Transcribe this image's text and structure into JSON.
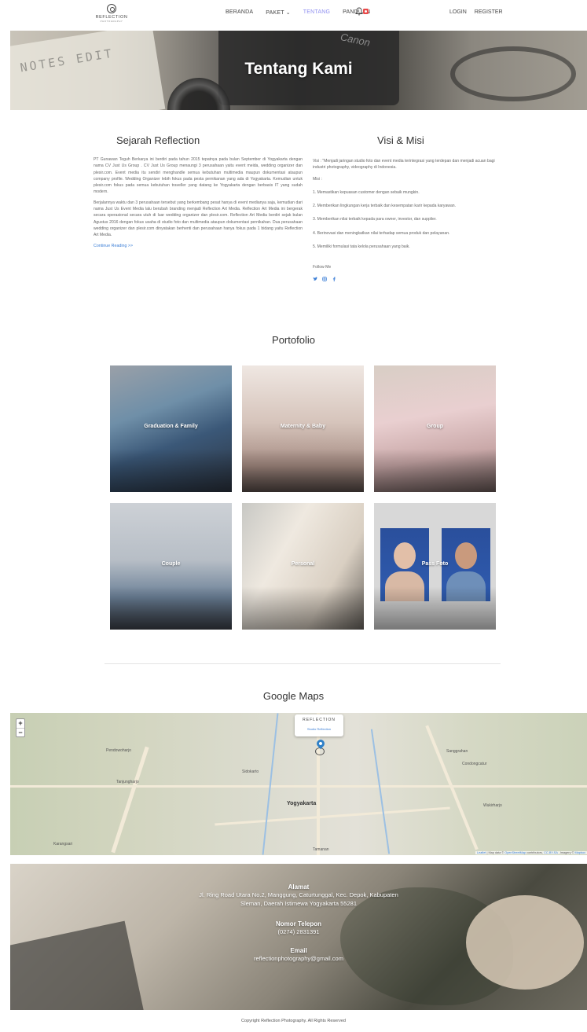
{
  "nav": {
    "logo": {
      "text": "REFLECTION",
      "sub": "PHOTOGRAPHY"
    },
    "items": [
      {
        "label": "BERANDA"
      },
      {
        "label": "PAKET ⌄"
      },
      {
        "label": "TENTANG"
      },
      {
        "label": "PANDUAN"
      }
    ],
    "login": "LOGIN",
    "register": "REGISTER",
    "icons": {
      "notification": "bell-icon",
      "badge_color": "#e84a4a"
    },
    "active_color": "#8f8ff0"
  },
  "hero": {
    "title": "Tentang Kami",
    "bg_text": "NOTES EDIT",
    "brand": "Canon"
  },
  "sejarah": {
    "title": "Sejarah Reflection",
    "p1": "PT Gunawan Teguh Berkarya ini berdiri pada tahun 2015 tepatnya pada bulan September di Yogyakarta dengan nama CV Just Us Group . CV Just Us Group menaungi 3 perusahaan yaitu event meida, wedding organizer dan plesir.com. Event media itu sendiri menghandle semua kebutuhan multimedia maupun dokumentasi ataupun company profile. Wedding Organizer lebih fokus pada pesta pernikanan yang ada di Yogyakarta. Kemudian untuk plesir.com fokus pada semua kebutuhan traveller yang datang ke Yogyakarta dengan berbasis IT yang sudah modern.",
    "p2": "Berjalannya waktu dan 3 perusahaan tersebut yang berkembang pesat hanya di event medianya saja, kemudian dari nama Just Us Event Media lalu berubah branding menjadi Reflection Art Media. Reflection Art Media ini bergerak secara operasional secara utuh di luar wedding organizer dan plesir.com. Reflection Art Media berdiri sejak bulan Agustus 2016 dengan fokus usaha di studio foto dan multimedia ataupun dokumentasi pernikahan. Dua perusahaan wedding organizer dan plesir.com dinyatakan berhenti dan perusahaan hanya fokus pada 1 bidang yaitu Reflection Art Media.",
    "continue": "Continue Reading >>"
  },
  "visi": {
    "title": "Visi & Misi",
    "visi_text": "Visi : \"Menjadi jaringan studio foto dan event media terintegrasi yang terdepan dan menjadi acuan bagi industri photography, videography di Indonesia.",
    "misi_label": "Misi :",
    "misi": [
      "1. Memastikan kepuasan customer dengan sebaik mungkin.",
      "2. Memberikan lingkungan kerja terbaik dan kesempatan karir kepada karyawan.",
      "3. Memberikan nilai terbaik kepada para owner, investor, dan supplier.",
      "4. Berinovasi dan meningkatkan nilai terhadap semua produk dan pelayanan.",
      "5. Memiliki formulasi tata kelola perusahaan yang baik."
    ],
    "follow": "Follow Me",
    "social": [
      "twitter-icon",
      "instagram-icon",
      "facebook-icon"
    ]
  },
  "portfolio": {
    "title": "Portofolio",
    "items": [
      {
        "label": "Graduation & Family"
      },
      {
        "label": "Maternity & Baby"
      },
      {
        "label": "Group"
      },
      {
        "label": "Couple"
      },
      {
        "label": "Personal"
      },
      {
        "label": "Pass Foto"
      }
    ]
  },
  "maps": {
    "title": "Google Maps",
    "zoom_in": "+",
    "zoom_out": "−",
    "popup_logo": "REFLECTION",
    "popup_link": "Studio Reflection",
    "labels": {
      "city": "Yogyakarta",
      "t1": "Pendowoharjo",
      "t2": "Tanjungharjo",
      "t3": "Sidokarto",
      "t4": "Karangsari",
      "t5": "Tamanan",
      "t6": "Sanggrahan",
      "t7": "Condongcatur",
      "t8": "Wukirharjo"
    },
    "attribution": {
      "leaflet": "Leaflet",
      "text": "| Map data ©",
      "osm": "OpenStreetMap",
      "contrib": "contributors,",
      "license": "CC-BY-SA",
      "imagery": ", Imagery ©",
      "mapbox": "Mapbox"
    }
  },
  "contact": {
    "alamat_label": "Alamat",
    "alamat_line1": "Jl. Ring Road Utara No.2, Manggung, Caturtunggal, Kec. Depok, Kabupaten",
    "alamat_line2": "Sleman, Daerah Istimewa Yogyakarta 55281",
    "telepon_label": "Nomor Telepon",
    "telepon": "(0274) 2831391",
    "email_label": "Email",
    "email": "reflectionphotography@gmail.com"
  },
  "footer": {
    "copyright": "Copyright Reflection Photography. All Rights Reserved"
  }
}
